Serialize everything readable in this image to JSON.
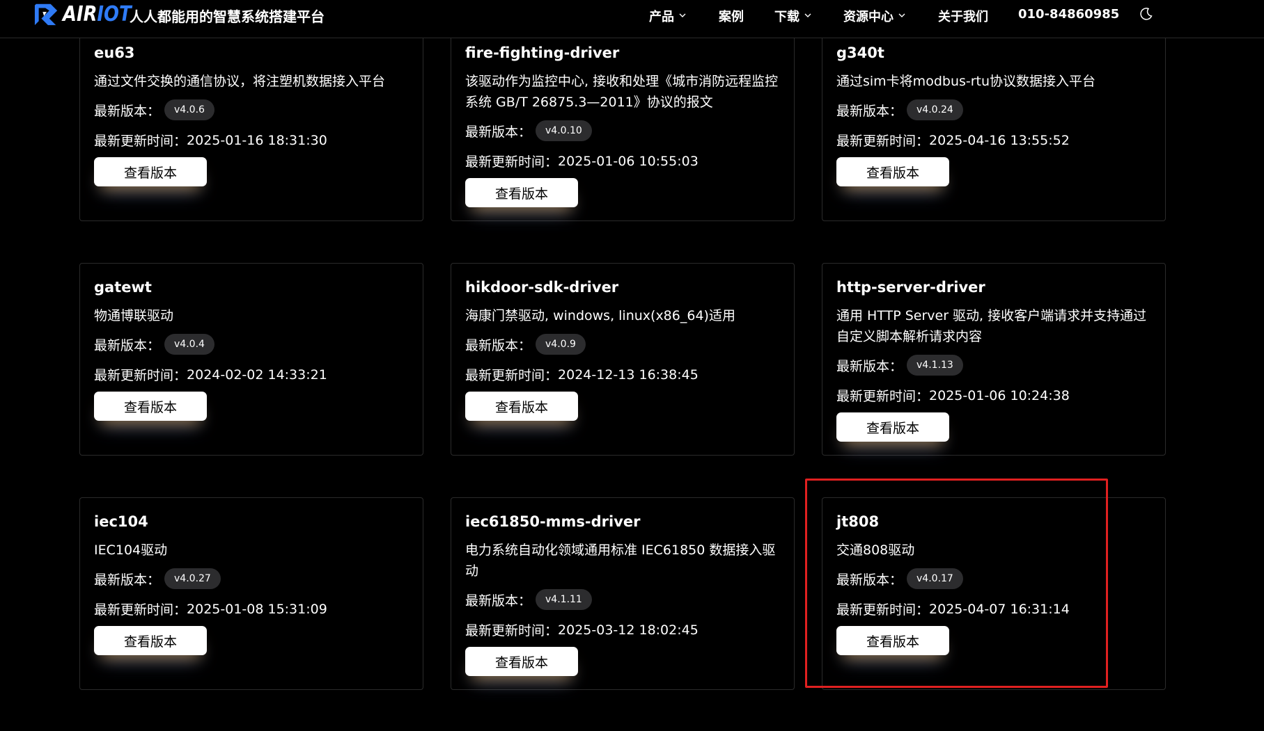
{
  "header": {
    "logo_text_a": "AIR",
    "logo_text_b": "IOT",
    "tagline": "人人都能用的智慧系统搭建平台",
    "nav": [
      {
        "label": "产品",
        "has_dropdown": true
      },
      {
        "label": "案例",
        "has_dropdown": false
      },
      {
        "label": "下载",
        "has_dropdown": true
      },
      {
        "label": "资源中心",
        "has_dropdown": true
      },
      {
        "label": "关于我们",
        "has_dropdown": false
      },
      {
        "label": "010-84860985",
        "has_dropdown": false
      }
    ],
    "theme_icon": "moon-icon"
  },
  "labels": {
    "version": "最新版本：",
    "updated": "最新更新时间：",
    "button": "查看版本"
  },
  "cards": [
    {
      "title": "eu63",
      "desc": "通过文件交换的通信协议，将注塑机数据接入平台",
      "version": "v4.0.6",
      "updated": "2025-01-16 18:31:30"
    },
    {
      "title": "fire-fighting-driver",
      "desc": "该驱动作为监控中心, 接收和处理《城市消防远程监控系统 GB/T 26875.3—2011》协议的报文",
      "version": "v4.0.10",
      "updated": "2025-01-06 10:55:03"
    },
    {
      "title": "g340t",
      "desc": "通过sim卡将modbus-rtu协议数据接入平台",
      "version": "v4.0.24",
      "updated": "2025-04-16 13:55:52"
    },
    {
      "title": "gatewt",
      "desc": "物通博联驱动",
      "version": "v4.0.4",
      "updated": "2024-02-02 14:33:21"
    },
    {
      "title": "hikdoor-sdk-driver",
      "desc": "海康门禁驱动, windows, linux(x86_64)适用",
      "version": "v4.0.9",
      "updated": "2024-12-13 16:38:45"
    },
    {
      "title": "http-server-driver",
      "desc": "通用 HTTP Server 驱动, 接收客户端请求并支持通过自定义脚本解析请求内容",
      "version": "v4.1.13",
      "updated": "2025-01-06 10:24:38"
    },
    {
      "title": "iec104",
      "desc": "IEC104驱动",
      "version": "v4.0.27",
      "updated": "2025-01-08 15:31:09"
    },
    {
      "title": "iec61850-mms-driver",
      "desc": "电力系统自动化领域通用标准 IEC61850 数据接入驱动",
      "version": "v4.1.11",
      "updated": "2025-03-12 18:02:45"
    },
    {
      "title": "jt808",
      "desc": "交通808驱动",
      "version": "v4.0.17",
      "updated": "2025-04-07 16:31:14"
    }
  ],
  "colors": {
    "background": "#000000",
    "badge": "#2c2c2e",
    "accent": "#2f7bf6",
    "highlight": "#e02020"
  }
}
